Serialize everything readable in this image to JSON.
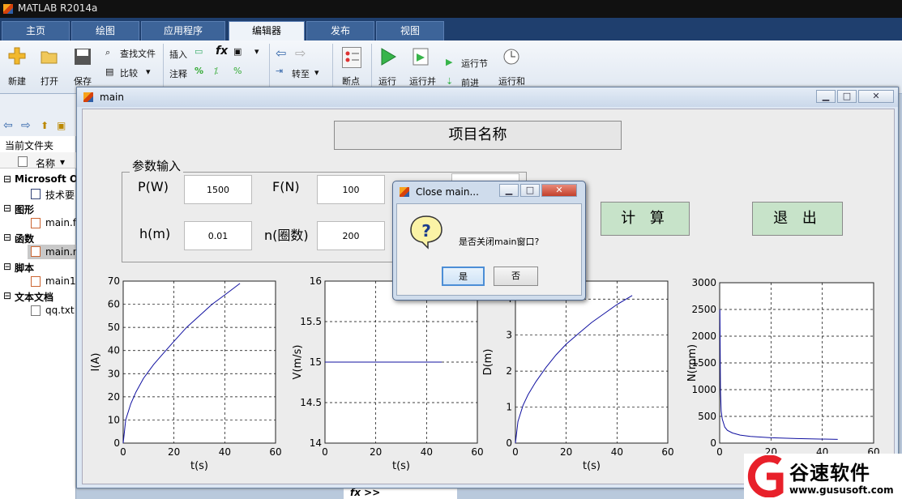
{
  "app": {
    "title": "MATLAB R2014a"
  },
  "tabs": [
    {
      "label": "主页"
    },
    {
      "label": "绘图"
    },
    {
      "label": "应用程序"
    },
    {
      "label": "编辑器"
    },
    {
      "label": "发布"
    },
    {
      "label": "视图"
    }
  ],
  "ribbon": {
    "new": "新建",
    "open": "打开",
    "save": "保存",
    "find_files": "查找文件",
    "compare": "比较",
    "insert": "插入",
    "comment": "注释",
    "goto": "转至",
    "breakpoints": "断点",
    "run": "运行",
    "run_advance": "运行并",
    "run_section": "运行节",
    "advance": "前进",
    "run_time": "运行和",
    "fx": "fx"
  },
  "file_browser": {
    "current_folder": "当前文件夹",
    "name_col": "名称",
    "groups": [
      {
        "label": "Microsoft O",
        "file": "技术要"
      },
      {
        "label": "图形",
        "file": "main.f"
      },
      {
        "label": "函数",
        "file": "main.n"
      },
      {
        "label": "脚本",
        "file": "main1"
      },
      {
        "label": "文本文档",
        "file": "qq.txt"
      }
    ]
  },
  "figure": {
    "title": "main",
    "project_name": "项目名称",
    "params_group": "参数输入",
    "labels": {
      "p": "P(W)",
      "f": "F(N)",
      "h": "h(m)",
      "n": "n(圈数)"
    },
    "values": {
      "p": "1500",
      "f": "100",
      "h": "0.01",
      "n": "200"
    },
    "calc_button": "计 算",
    "exit_button": "退 出"
  },
  "dialog": {
    "title": "Close main...",
    "message": "是否关闭main窗口?",
    "yes": "是",
    "no": "否",
    "icon": "question-icon"
  },
  "command": {
    "prompt": "fx >>"
  },
  "watermark": {
    "brand": "谷速软件",
    "url": "www.gususoft.com"
  },
  "chart_data": [
    {
      "type": "line",
      "xlabel": "t(s)",
      "ylabel": "I(A)",
      "xlim": [
        0,
        60
      ],
      "ylim": [
        0,
        70
      ],
      "xticks": [
        "0",
        "20",
        "40",
        "60"
      ],
      "yticks": [
        "0",
        "10",
        "20",
        "30",
        "40",
        "50",
        "60",
        "70"
      ],
      "grid": true,
      "series": [
        {
          "x": [
            0,
            1,
            3,
            5,
            8,
            12,
            16,
            20,
            25,
            30,
            35,
            40,
            46
          ],
          "y": [
            0,
            10,
            17,
            22,
            28,
            34,
            39,
            44,
            50,
            55,
            60,
            64,
            69
          ]
        }
      ]
    },
    {
      "type": "line",
      "xlabel": "t(s)",
      "ylabel": "V(m/s)",
      "xlim": [
        0,
        60
      ],
      "ylim": [
        14,
        16
      ],
      "xticks": [
        "0",
        "20",
        "40",
        "60"
      ],
      "yticks": [
        "14",
        "14.5",
        "15",
        "15.5",
        "16"
      ],
      "grid": true,
      "series": [
        {
          "x": [
            0,
            46
          ],
          "y": [
            15,
            15
          ]
        }
      ]
    },
    {
      "type": "line",
      "xlabel": "t(s)",
      "ylabel": "D(m)",
      "xlim": [
        0,
        60
      ],
      "ylim": [
        0,
        4.5
      ],
      "xticks": [
        "0",
        "20",
        "40",
        "60"
      ],
      "yticks": [
        "0",
        "1",
        "2",
        "3",
        "4"
      ],
      "grid": true,
      "series": [
        {
          "x": [
            0,
            1,
            3,
            5,
            8,
            12,
            16,
            20,
            25,
            30,
            35,
            40,
            46
          ],
          "y": [
            0,
            0.6,
            1.05,
            1.35,
            1.7,
            2.1,
            2.45,
            2.75,
            3.05,
            3.35,
            3.6,
            3.85,
            4.1
          ]
        }
      ]
    },
    {
      "type": "line",
      "xlabel": "t(s)",
      "ylabel": "N(rpm)",
      "xlim": [
        0,
        60
      ],
      "ylim": [
        0,
        3000
      ],
      "xticks": [
        "0",
        "20",
        "40",
        "60"
      ],
      "yticks": [
        "0",
        "500",
        "1000",
        "1500",
        "2000",
        "2500",
        "3000"
      ],
      "grid": true,
      "series": [
        {
          "x": [
            0.1,
            0.3,
            0.6,
            1,
            2,
            3,
            5,
            8,
            12,
            20,
            30,
            46
          ],
          "y": [
            2500,
            1000,
            600,
            450,
            300,
            240,
            190,
            150,
            125,
            100,
            85,
            70
          ]
        }
      ]
    }
  ]
}
